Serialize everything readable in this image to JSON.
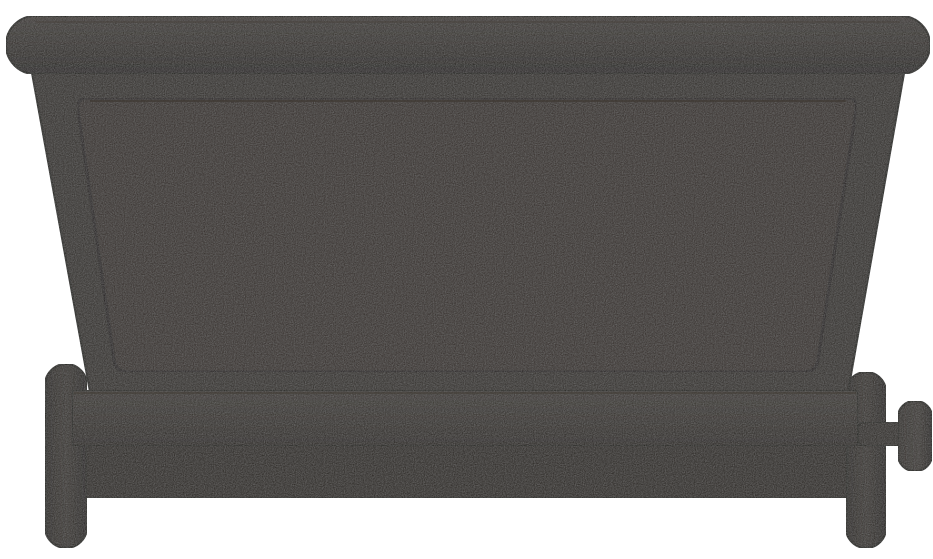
{
  "object": {
    "colors": {
      "iron_base": "#2f2b27",
      "iron_dark": "#1f1c19",
      "iron_light": "#3b3631",
      "iron_panel": "#332f2a",
      "iron_edge": "#16130f",
      "background": "#ffffff"
    }
  }
}
